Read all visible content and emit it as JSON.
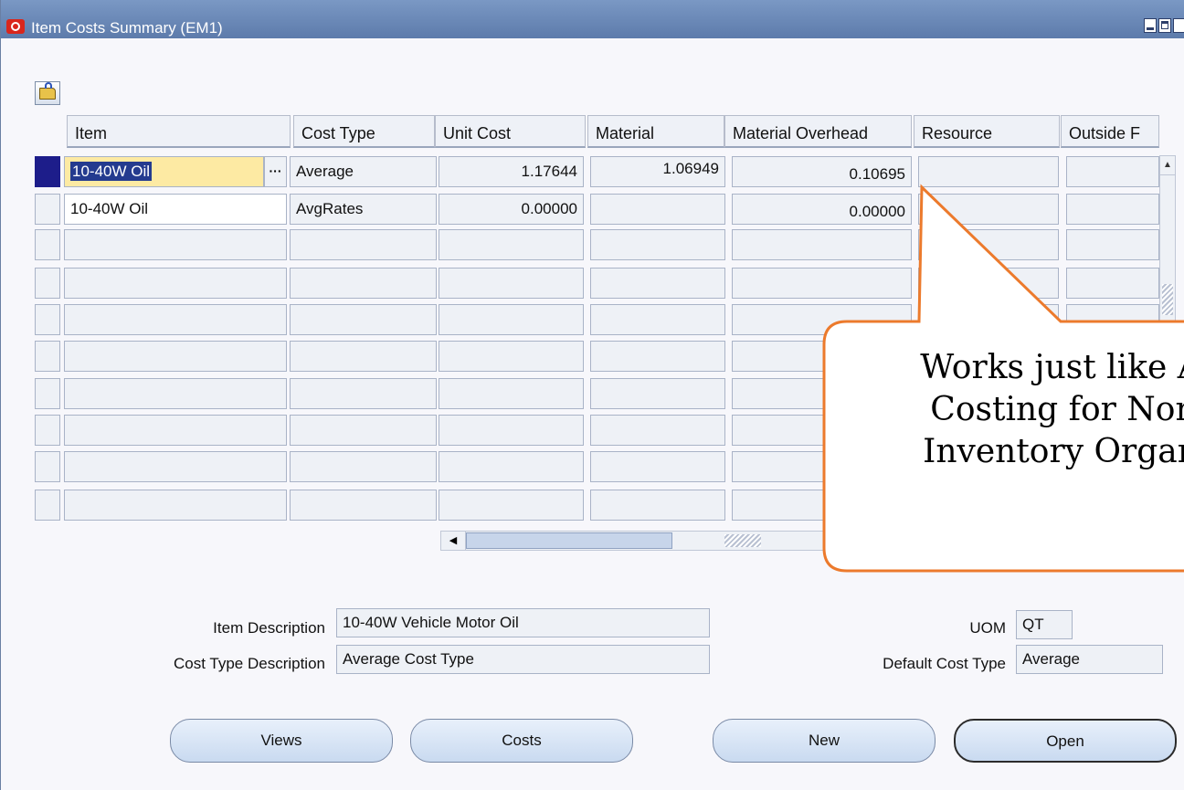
{
  "window": {
    "title": "Item Costs Summary (EM1)"
  },
  "grid": {
    "columns": [
      "Item",
      "Cost Type",
      "Unit Cost",
      "Material",
      "Material Overhead",
      "Resource",
      "Outside F"
    ],
    "rows": [
      {
        "item": "10-40W Oil",
        "cost_type": "Average",
        "unit_cost": "1.17644",
        "material": "1.06949",
        "material_overhead": "0.10695",
        "resource": "",
        "outside": ""
      },
      {
        "item": "10-40W Oil",
        "cost_type": "AvgRates",
        "unit_cost": "0.00000",
        "material": "",
        "material_overhead": "0.00000",
        "resource": "",
        "outside": ""
      }
    ],
    "lov_glyph": "···"
  },
  "details": {
    "item_description_label": "Item Description",
    "item_description": "10-40W Vehicle Motor Oil",
    "cost_type_description_label": "Cost Type Description",
    "cost_type_description": "Average Cost Type",
    "uom_label": "UOM",
    "uom": "QT",
    "default_cost_type_label": "Default Cost Type",
    "default_cost_type": "Average"
  },
  "buttons": {
    "views": "Views",
    "costs": "Costs",
    "new": "New",
    "open": "Open"
  },
  "callout": {
    "text": "Works just like Average Costing for Normal Inventory Organizations",
    "line1": "Works just like A",
    "line2": "Costing for Nor",
    "line3": "Inventory Organ",
    "border_color": "#ec7a2c"
  },
  "icons": {
    "app": "oracle-icon",
    "folder": "open-folder-icon"
  }
}
